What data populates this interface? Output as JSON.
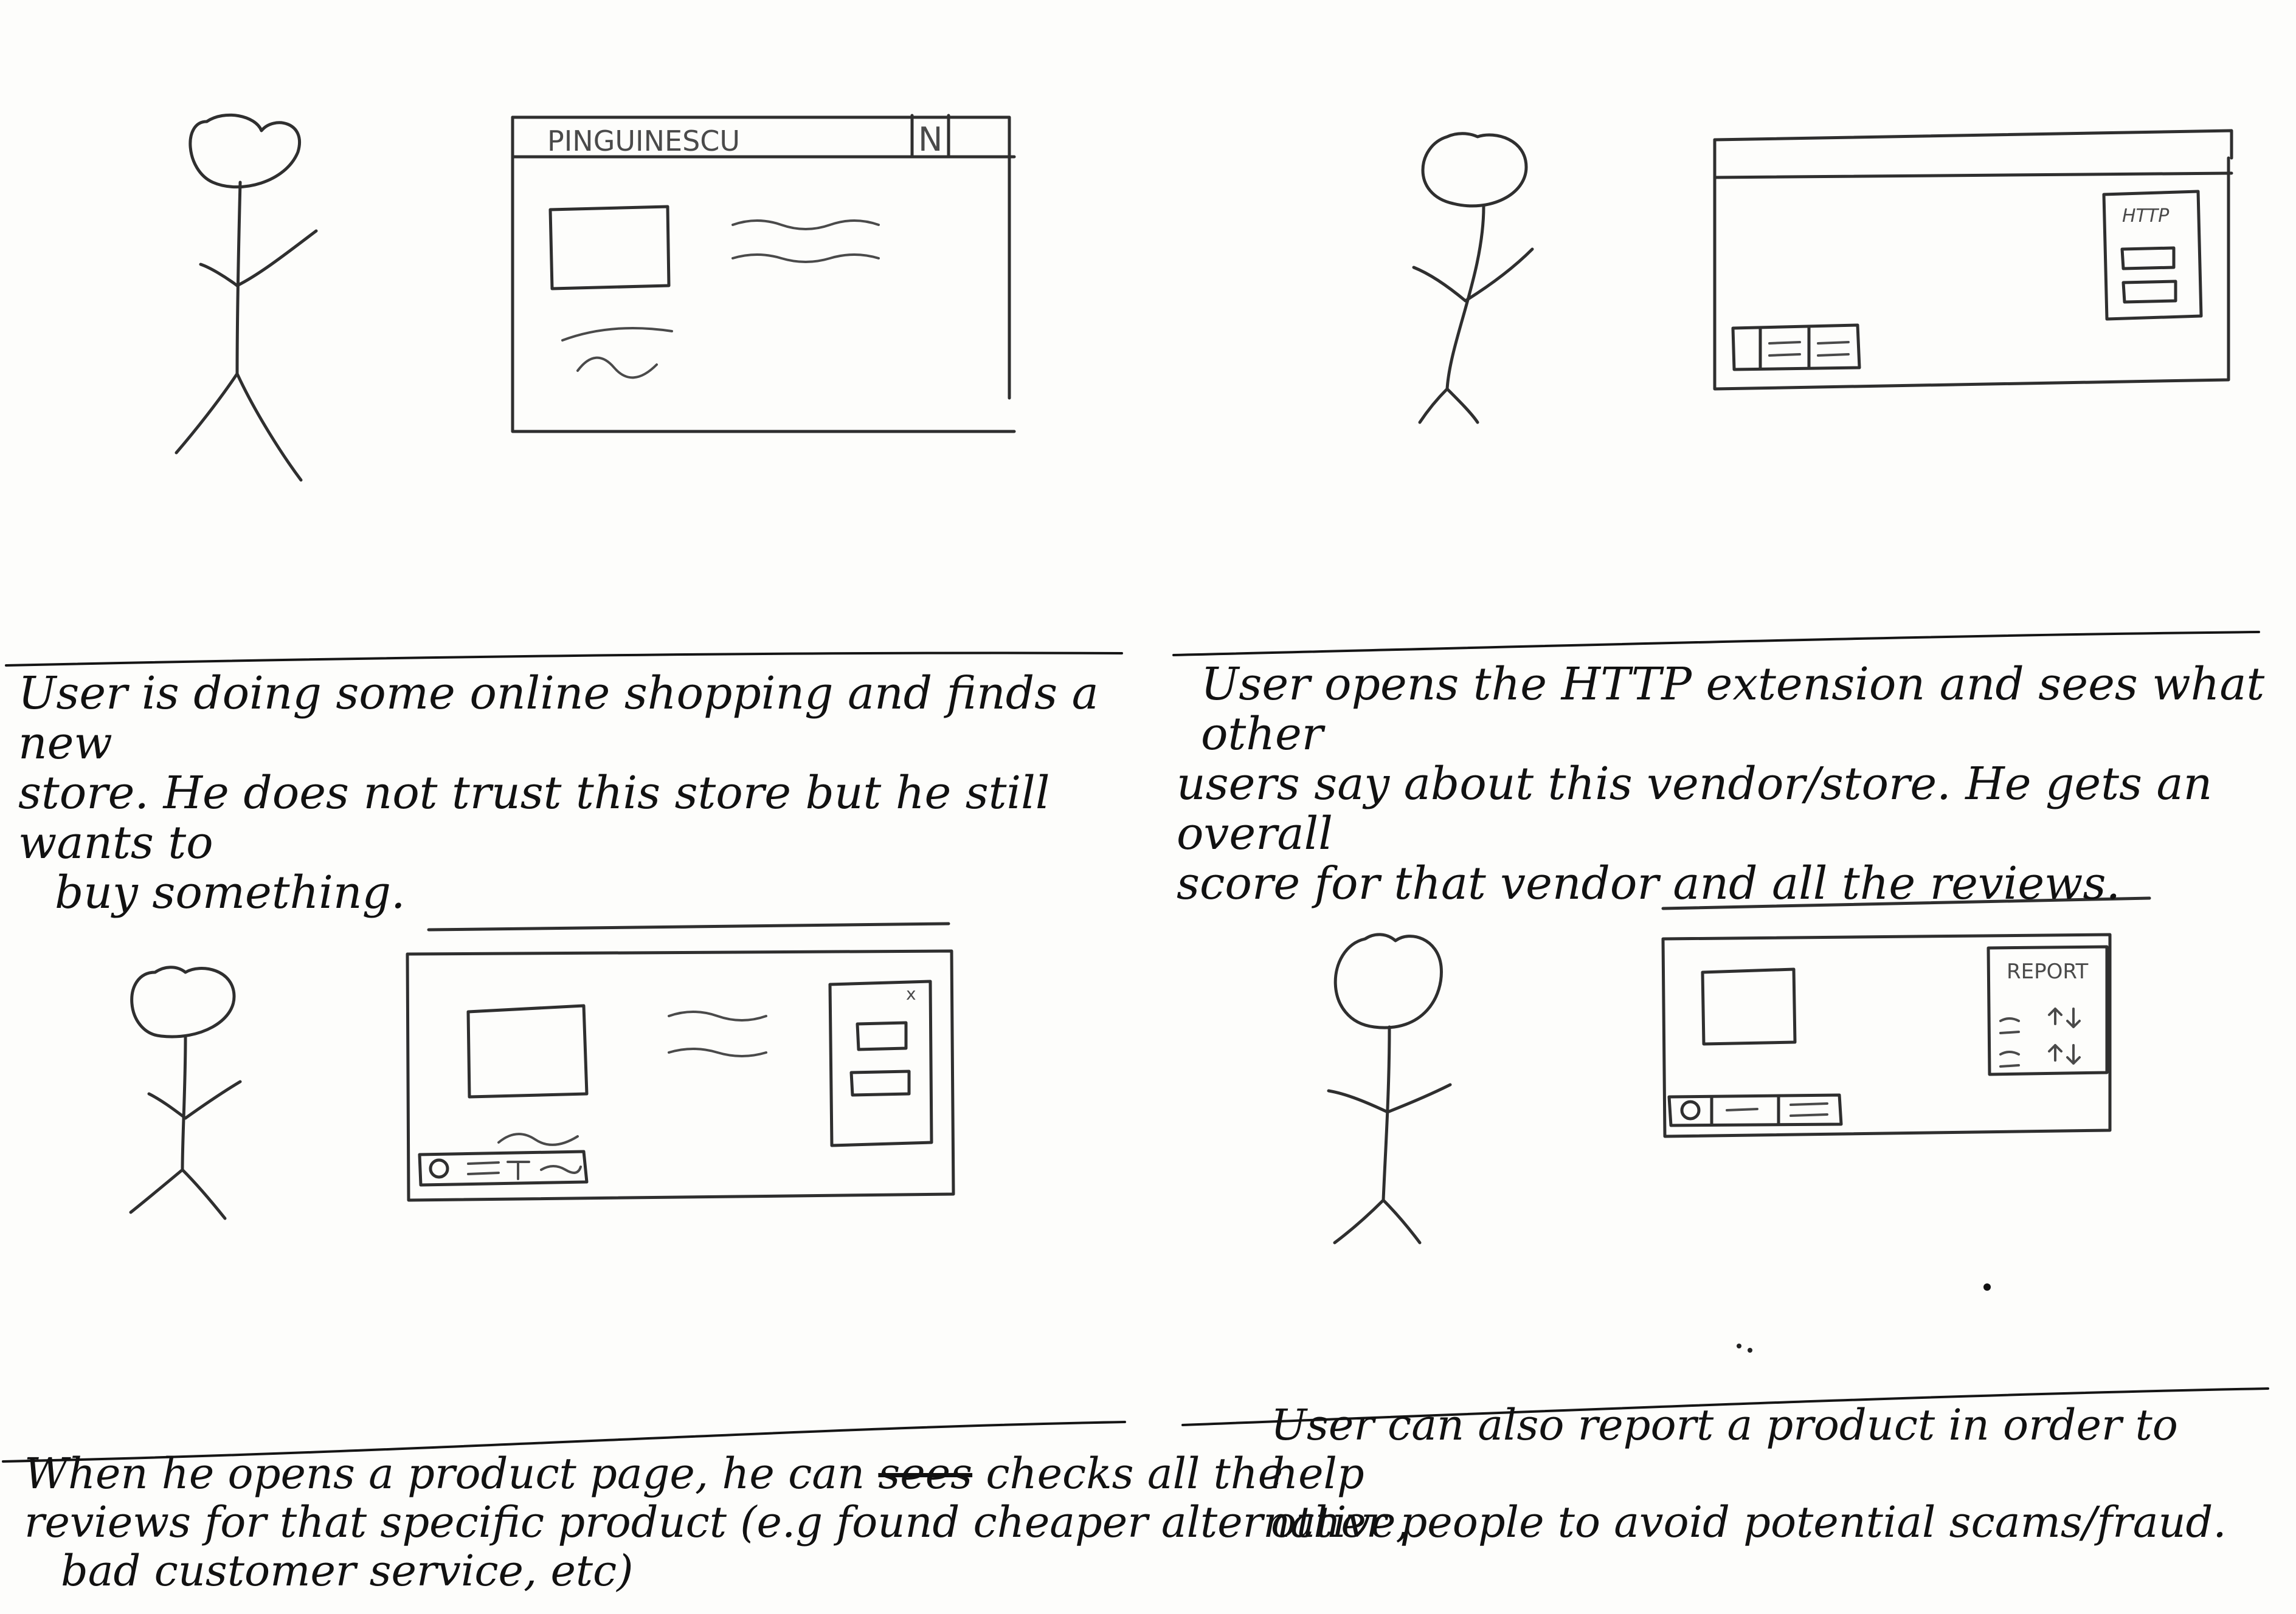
{
  "panel1": {
    "mock_title": "PINGUINESCU",
    "mock_corner_label": "N",
    "caption_lines": [
      "User is doing some online shopping and finds a new",
      "store. He does not trust this store but he still wants to",
      "buy something."
    ]
  },
  "panel2": {
    "extension_label": "HTTP",
    "caption_lines": [
      "User opens the HTTP extension and sees what other",
      "users say about this vendor/store. He gets an overall",
      "score for that vendor and all the reviews."
    ]
  },
  "panel3": {
    "popup_close": "x",
    "caption_parts": {
      "l1_before": "When he opens a product page, he can ",
      "l1_struck": "sees",
      "l1_after": " checks all the",
      "l2": "reviews for that specific product (e.g found cheaper alternative,",
      "l3": "bad customer service, etc)"
    }
  },
  "panel4": {
    "report_label": "REPORT",
    "caption_lines": [
      "User can also report a product in order to help",
      "other people to avoid potential scams/fraud."
    ]
  }
}
